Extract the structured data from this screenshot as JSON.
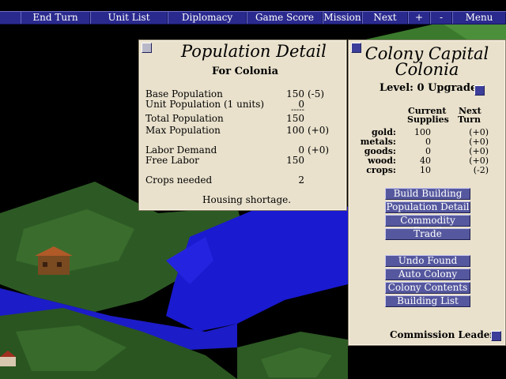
{
  "topbar": {
    "items": [
      "End Turn",
      "Unit List",
      "Diplomacy",
      "Game Score",
      "Mission",
      "Next",
      "+",
      "-",
      "Menu"
    ]
  },
  "population": {
    "title": "Population Detail",
    "subtitle": "For Colonia",
    "rows": [
      {
        "label": "Base Population",
        "value": "150",
        "delta": "(-5)"
      },
      {
        "label": "Unit Population (1 units)",
        "value": "0",
        "delta": ""
      },
      {
        "label": "",
        "value": "-----",
        "delta": ""
      },
      {
        "label": "Total Population",
        "value": "150",
        "delta": ""
      },
      {
        "label": "Max Population",
        "value": "100",
        "delta": "(+0)"
      },
      {
        "label": "Labor Demand",
        "value": "0",
        "delta": "(+0)"
      },
      {
        "label": "Free Labor",
        "value": "150",
        "delta": ""
      },
      {
        "label": "Crops needed",
        "value": "2",
        "delta": ""
      }
    ],
    "message": "Housing shortage."
  },
  "colony": {
    "title_line1": "Colony Capital",
    "title_line2": "Colonia",
    "level": "Level: 0 Upgrade",
    "col_current": [
      "Current",
      "Supplies"
    ],
    "col_next": [
      "Next",
      "Turn"
    ],
    "resources": [
      {
        "name": "gold:",
        "current": "100",
        "next": "(+0)"
      },
      {
        "name": "metals:",
        "current": "0",
        "next": "(+0)"
      },
      {
        "name": "goods:",
        "current": "0",
        "next": "(+0)"
      },
      {
        "name": "wood:",
        "current": "40",
        "next": "(+0)"
      },
      {
        "name": "crops:",
        "current": "10",
        "next": "(-2)"
      }
    ],
    "buttons_top": [
      "Build Building",
      "Population Detail",
      "Commodity Detail",
      "Trade"
    ],
    "buttons_bottom": [
      "Undo Found",
      "Auto Colony",
      "Colony Contents",
      "Building List"
    ],
    "commission_label": "Commission Leader"
  },
  "colors": {
    "topbar": "#2a2a8e",
    "parchment": "#e9e1cc",
    "button": "#55589e",
    "water": "#1a1ad0",
    "land": "#2e5a22"
  }
}
